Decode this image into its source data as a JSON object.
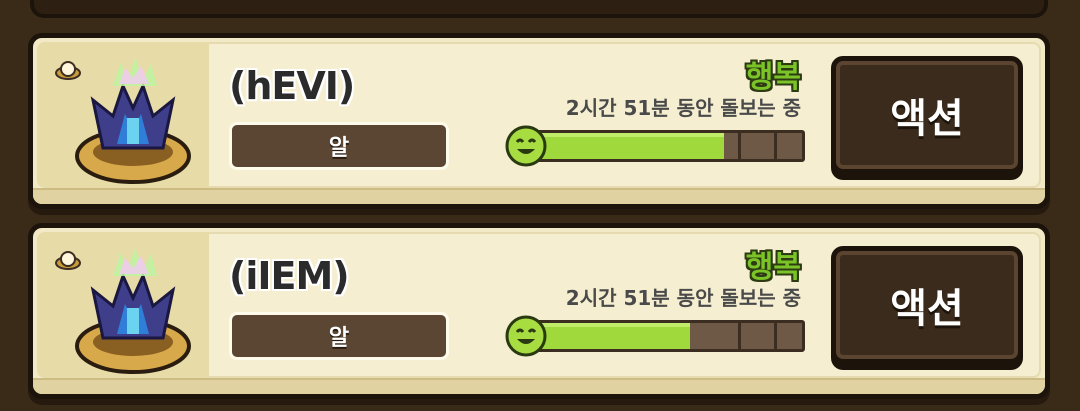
{
  "pets": [
    {
      "name": "(hEVI)",
      "stage": "알",
      "mood": "행복",
      "care_time": "2시간 51분 동안 돌보는 중",
      "happiness_fraction": 0.72,
      "action_label": "액션"
    },
    {
      "name": "(iIEM)",
      "stage": "알",
      "mood": "행복",
      "care_time": "2시간 51분 동안 돌보는 중",
      "happiness_fraction": 0.6,
      "action_label": "액션"
    }
  ],
  "colors": {
    "mood_green": "#7bc427",
    "bar_fill": "#9fd93b",
    "card_bg": "#f2e9c6",
    "frame_dark": "#1c130a",
    "button_bg": "#3b2b1c"
  },
  "icons": {
    "egg_badge": "egg-icon",
    "pet": "egg-pet-sprite",
    "smile": "happy-face-icon"
  }
}
